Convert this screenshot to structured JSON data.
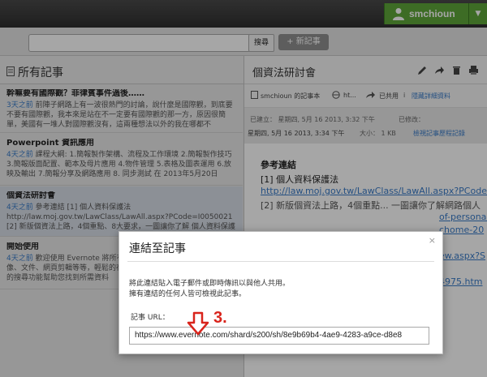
{
  "user": {
    "name": "smchioun"
  },
  "search": {
    "placeholder": "",
    "button_label": "搜尋",
    "new_note_label": "+ 新記事"
  },
  "left_panel": {
    "title": "所有記事",
    "notes": [
      {
        "title": "幹嘛要有國際觀？菲律賓事件過後……",
        "age": "3天之前",
        "snippet": " 前陣子網路上有一波很熱門的討論，說什麼是國際觀，到底要不要有國際觀，我本來是站在不一定要有國際觀的那一方，原因很簡 單，美國有一堆人對國際觀沒有，這兩種想法以外的我在哪都不"
      },
      {
        "title": "Powerpoint 資訊應用",
        "age": "4天之前",
        "snippet": " 課程大綱: 1.簡報製作架構、流程及工作環境 2.簡報製作技巧 3.簡報版面配置、範本及母片應用 4.物件管理 5.表格及圖表運用 6.放映及輸出 7.簡報分享及網路應用 8. 同步測試 在 2013年5月20日"
      },
      {
        "title": "個資法研討會",
        "age": "4天之前",
        "snippet": " 參考連結 [1] 個人資料保護法 http://law.moj.gov.tw/LawClass/LawAll.aspx?PCode=I0050021 [2] 新版個資法上路，4個重點、8大要求，一圖讓你了解 個人資料保護法"
      },
      {
        "title": "開始使用",
        "age": "4天之前",
        "snippet": " 歡迎使用 Evernote 將所有資料集中在一處 — 您的記事、影像、文件、網頁剪輯等等，輕鬆的在任何地方找到記事。使用我們強大的搜尋功能幫助您找到所需資料"
      }
    ]
  },
  "note_view": {
    "title": "個資法研討會",
    "notebook": "smchioun 的記事本",
    "web_link": "ht...",
    "shared": "已共用",
    "hide_details": "隱藏詳細資料",
    "created": "已建立： 星期四, 5月 16 2013, 3:32 下午",
    "modified_label": "已修改：",
    "modified": "星期四, 5月 16 2013, 3:34 下午",
    "size": "大小：  1 KB",
    "history_link": "檢視記事歷程記錄",
    "body_heading": "參考連結",
    "body_line1": "[1] 個人資料保護法",
    "body_url1": "http://law.moj.gov.tw/LawClass/LawAll.aspx?PCode=I0",
    "body_url2": "[2] 新版個資法上路，4個重點... 一圖讓你了解網路個人",
    "body_url3": "of-personal",
    "body_url4": "chome-20",
    "body_url5": "ew.aspx?S",
    "body_url6": "4975.htm"
  },
  "dialog": {
    "title": "連結至記事",
    "close": "×",
    "message_line1": "將此連結貼入電子郵件或即時傳訊以與他人共用。",
    "message_line2": "擁有連結的任何人皆可檢視此記事。",
    "url_label": "記事 URL：",
    "url_value": "https://www.evernote.com/shard/s200/sh/8e9b69b4-4ae9-4283-a9ce-d8e8"
  },
  "annotation": {
    "label": "3."
  },
  "colors": {
    "accent_green": "#5fa63a",
    "link_blue": "#3a7bc8",
    "annotation_red": "#d9241c"
  }
}
